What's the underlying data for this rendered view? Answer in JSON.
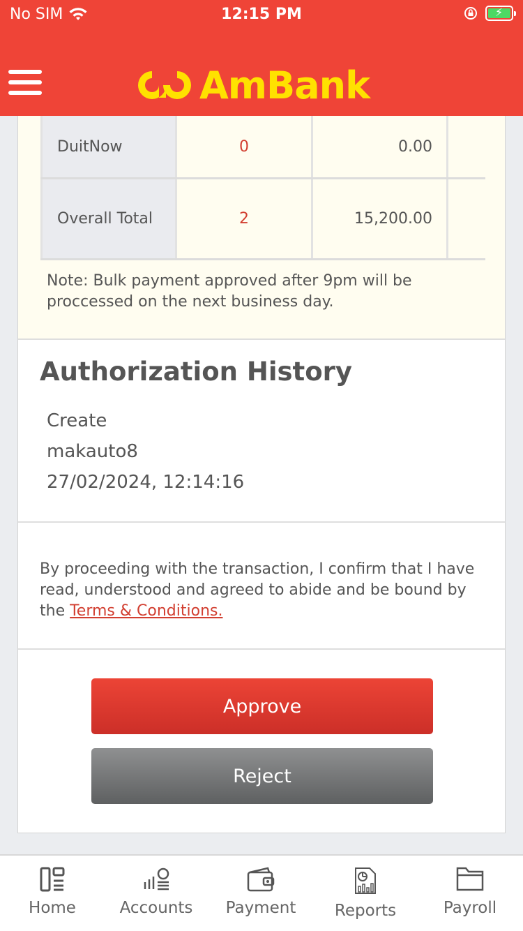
{
  "status_bar": {
    "carrier": "No SIM",
    "time": "12:15 PM"
  },
  "header": {
    "brand": "AmBank",
    "colors": {
      "header_bg": "#ef4437",
      "logo": "#ffe100"
    }
  },
  "summary": {
    "rows": [
      {
        "label": "DuitNow",
        "count": "0",
        "amount": "0.00"
      },
      {
        "label": "Overall Total",
        "count": "2",
        "amount": "15,200.00"
      }
    ],
    "note": "Note: Bulk payment approved after 9pm will be proccessed on the next business day."
  },
  "authorization_history": {
    "title": "Authorization History",
    "action": "Create",
    "user": "makauto8",
    "timestamp": "27/02/2024, 12:14:16"
  },
  "terms": {
    "text": "By proceeding with the transaction, I confirm that I have read, understood and agreed to abide and be bound by the ",
    "link_label": "Terms & Conditions."
  },
  "actions": {
    "approve_label": "Approve",
    "reject_label": "Reject"
  },
  "tabbar": {
    "items": [
      {
        "label": "Home",
        "icon": "home-icon"
      },
      {
        "label": "Accounts",
        "icon": "accounts-icon"
      },
      {
        "label": "Payment",
        "icon": "wallet-icon"
      },
      {
        "label": "Reports",
        "icon": "report-icon"
      },
      {
        "label": "Payroll",
        "icon": "folder-icon"
      }
    ]
  }
}
